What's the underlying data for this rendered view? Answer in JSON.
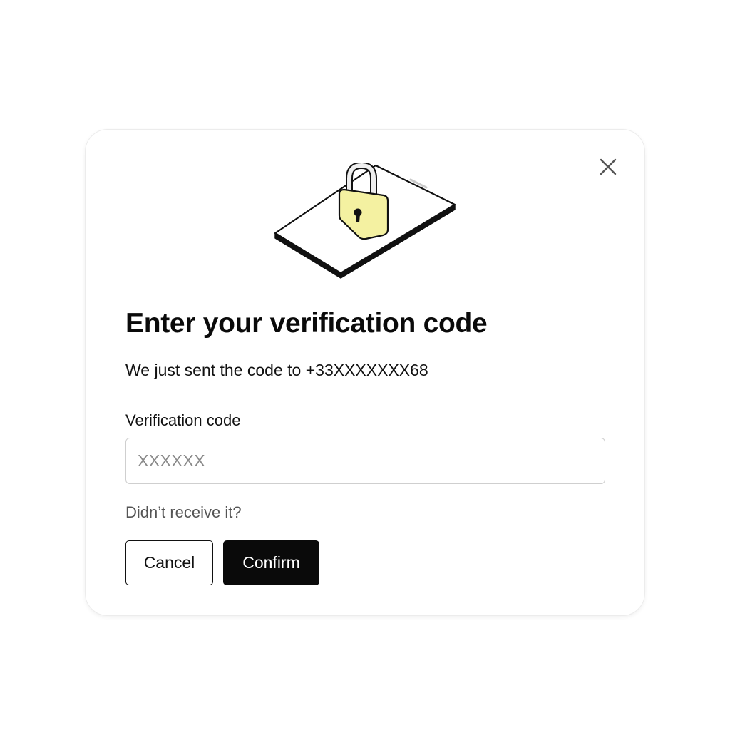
{
  "dialog": {
    "title": "Enter your verification code",
    "subtitle": "We just sent the code to +33XXXXXXX68",
    "close_icon": "close-icon",
    "illustration_icon": "phone-with-padlock-illustration"
  },
  "form": {
    "code_label": "Verification code",
    "code_placeholder": "XXXXXX",
    "code_value": "",
    "resend_text": "Didn’t receive it?"
  },
  "actions": {
    "cancel_label": "Cancel",
    "confirm_label": "Confirm"
  },
  "colors": {
    "accent": "#0a0a0a",
    "lock_fill": "#f4f1a1",
    "muted_text": "#555555",
    "input_border": "#cfcfcf"
  }
}
